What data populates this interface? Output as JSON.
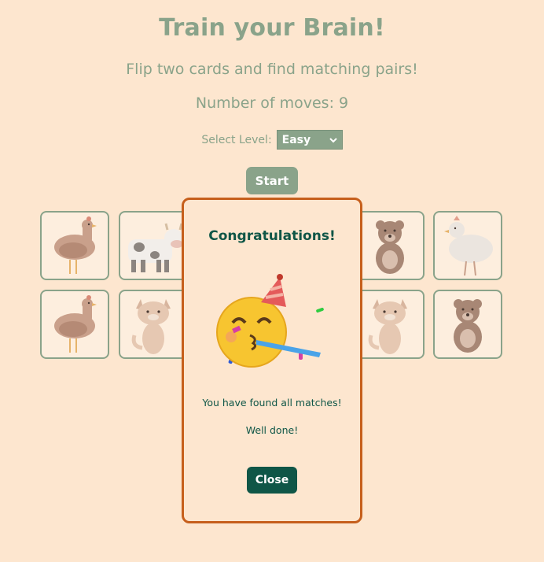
{
  "header": {
    "title": "Train your Brain!",
    "subtitle": "Flip two cards and find matching pairs!",
    "moves_label": "Number of moves: 9"
  },
  "controls": {
    "level_label": "Select Level:",
    "level_value": "Easy",
    "start_label": "Start"
  },
  "board": {
    "cards": [
      {
        "animal": "chicken"
      },
      {
        "animal": "cow"
      },
      {
        "animal": "bear"
      },
      {
        "animal": "hen"
      },
      {
        "animal": "chicken"
      },
      {
        "animal": "cat"
      },
      {
        "animal": "cat"
      },
      {
        "animal": "bear"
      }
    ]
  },
  "modal": {
    "title": "Congratulations!",
    "emoji": "party-face-icon",
    "message": "You have found all matches!",
    "sub_message": "Well done!",
    "close_label": "Close"
  },
  "colors": {
    "background": "#fde6cf",
    "accent_green": "#8aa38a",
    "dark_green": "#0f5647",
    "modal_border": "#c65f1c"
  }
}
